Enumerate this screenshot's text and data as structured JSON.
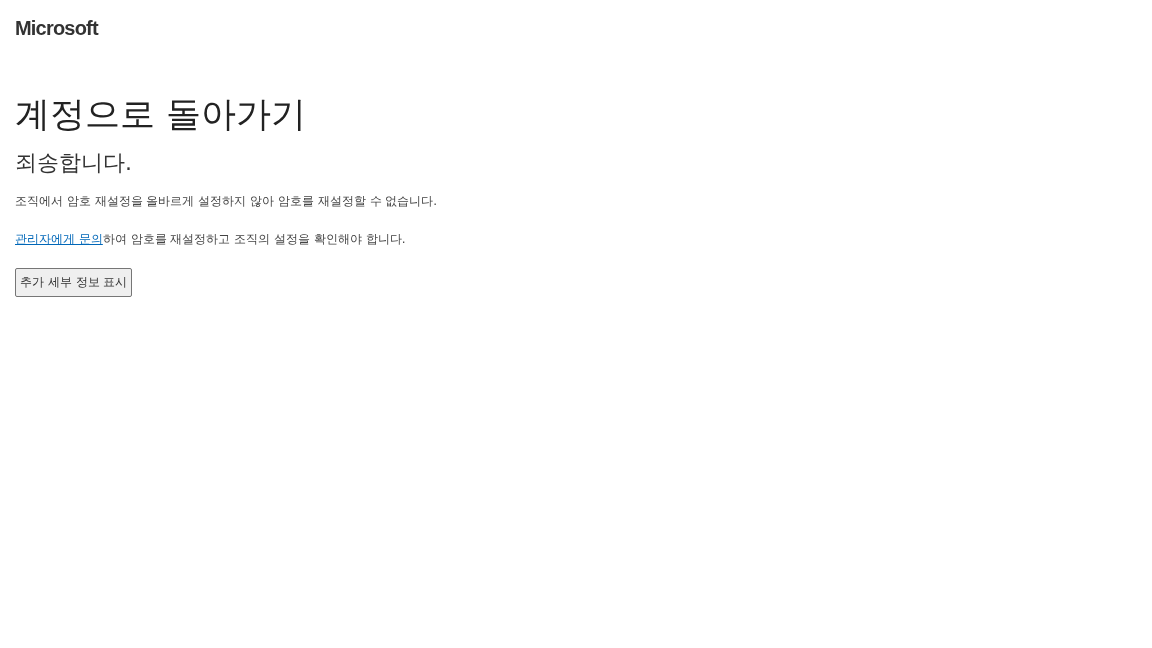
{
  "logo": {
    "text": "Microsoft"
  },
  "title": "계정으로 돌아가기",
  "subtitle": "죄송합니다.",
  "message": "조직에서 암호 재설정을 올바르게 설정하지 않아 암호를 재설정할 수 없습니다.",
  "contact": {
    "link": "관리자에게 문의",
    "rest": "하여 암호를 재설정하고 조직의 설정을 확인해야 합니다."
  },
  "buttons": [
    {
      "label": "추가 세부 정보 표시"
    }
  ]
}
